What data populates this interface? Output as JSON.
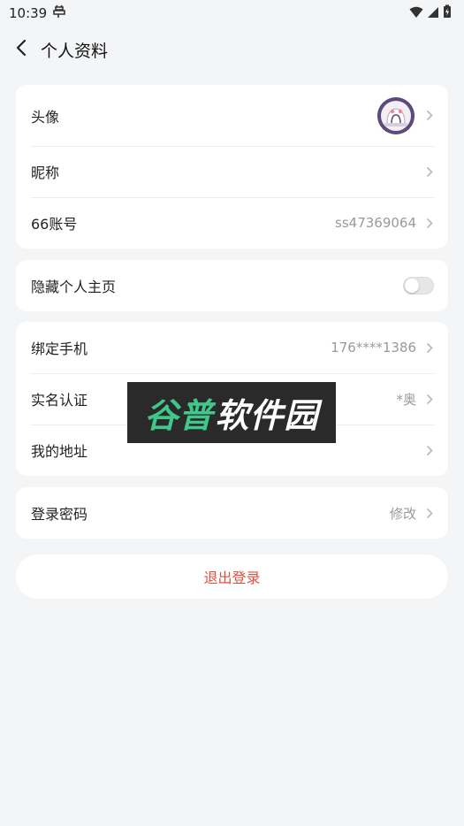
{
  "status_bar": {
    "time": "10:39"
  },
  "header": {
    "title": "个人资料"
  },
  "profile_card": {
    "avatar_label": "头像",
    "nickname_label": "昵称",
    "nickname_value": "",
    "account_label": "66账号",
    "account_value": "ss47369064"
  },
  "privacy_card": {
    "hide_homepage_label": "隐藏个人主页",
    "hide_homepage_enabled": false
  },
  "binding_card": {
    "phone_label": "绑定手机",
    "phone_value": "176****1386",
    "realname_label": "实名认证",
    "realname_value": "*奥",
    "address_label": "我的地址",
    "address_value": ""
  },
  "security_card": {
    "password_label": "登录密码",
    "password_value": "修改"
  },
  "logout": {
    "label": "退出登录",
    "color": "#e0503f"
  },
  "watermark": {
    "text_green": "谷普",
    "text_white": "软件园"
  },
  "colors": {
    "background": "#f4f5f7",
    "card": "#ffffff",
    "secondary_text": "#9a9a9a",
    "toggle_off": "#e6e6e8"
  },
  "icons": [
    "back-arrow-icon",
    "wifi-icon",
    "signal-icon",
    "battery-icon",
    "chevron-right-icon",
    "notification-icon"
  ]
}
